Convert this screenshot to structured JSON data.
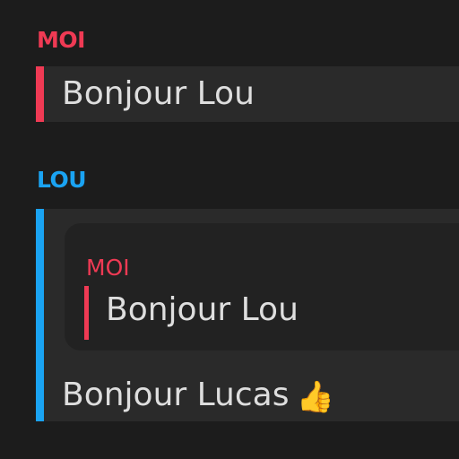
{
  "messages": [
    {
      "sender": "MOI",
      "text": "Bonjour Lou",
      "sender_color": "#ef3a54"
    },
    {
      "sender": "LOU",
      "text": "Bonjour Lucas",
      "emoji": "👍",
      "sender_color": "#1aa3f2",
      "reply_to": {
        "sender": "MOI",
        "text": "Bonjour Lou",
        "sender_color": "#ef3a54"
      }
    }
  ]
}
